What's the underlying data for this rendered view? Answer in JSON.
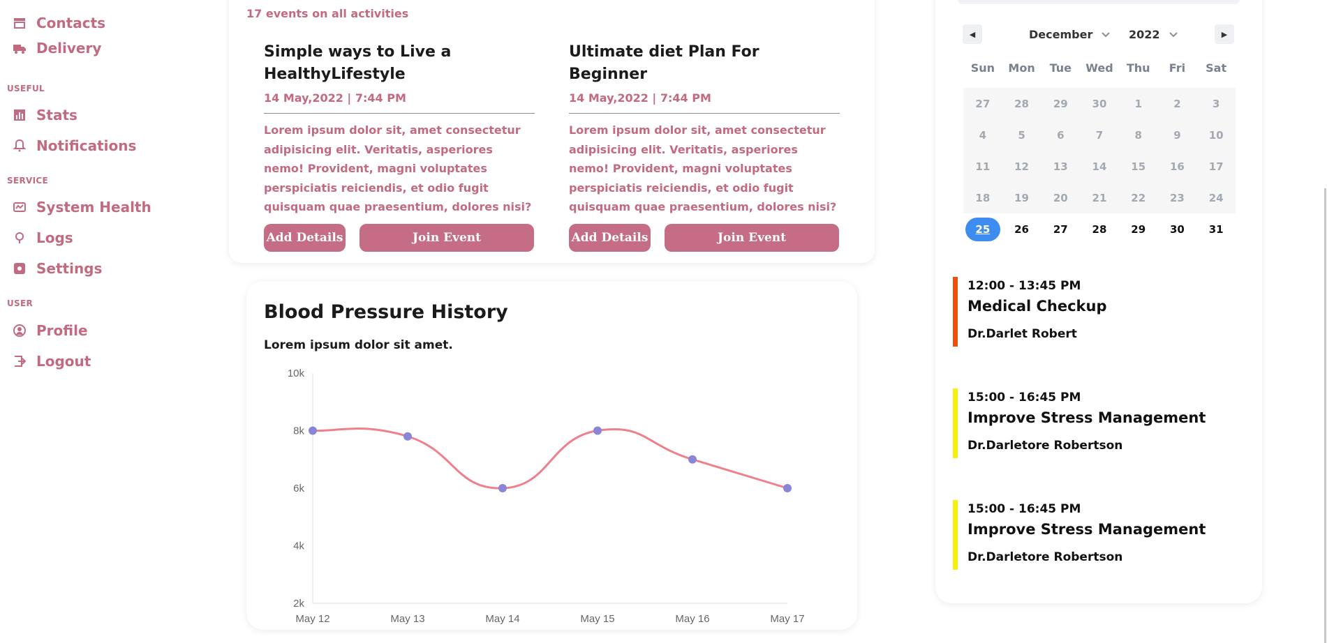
{
  "sidebar": {
    "items_top": [
      {
        "label": "Contacts",
        "icon": "store-icon"
      },
      {
        "label": "Delivery",
        "icon": "truck-icon"
      }
    ],
    "sections": [
      {
        "label": "USEFUL",
        "items": [
          {
            "label": "Stats",
            "icon": "chart-icon"
          },
          {
            "label": "Notifications",
            "icon": "bell-icon"
          }
        ]
      },
      {
        "label": "SERVICE",
        "items": [
          {
            "label": "System Health",
            "icon": "health-icon"
          },
          {
            "label": "Logs",
            "icon": "logs-icon"
          },
          {
            "label": "Settings",
            "icon": "settings-icon"
          }
        ]
      },
      {
        "label": "USER",
        "items": [
          {
            "label": "Profile",
            "icon": "user-icon"
          },
          {
            "label": "Logout",
            "icon": "logout-icon"
          }
        ]
      }
    ]
  },
  "events": {
    "count_text": "17 events on all activities",
    "items": [
      {
        "title": "Simple ways to Live a HealthyLifestyle",
        "date": "14 May,2022 | 7:44 PM",
        "description": "Lorem ipsum dolor sit, amet consectetur adipisicing elit. Veritatis, asperiores nemo! Provident, magni voluptates perspiciatis reiciendis, et odio fugit quisquam quae praesentium, dolores nisi?",
        "details_label": "Add Details",
        "join_label": "Join Event"
      },
      {
        "title": "Ultimate diet Plan For Beginner",
        "date": "14 May,2022 | 7:44 PM",
        "description": "Lorem ipsum dolor sit, amet consectetur adipisicing elit. Veritatis, asperiores nemo! Provident, magni voluptates perspiciatis reiciendis, et odio fugit quisquam quae praesentium, dolores nisi?",
        "details_label": "Add Details",
        "join_label": "Join Event"
      }
    ]
  },
  "chart_card": {
    "title": "Blood Pressure History",
    "subtitle": "Lorem ipsum dolor sit amet."
  },
  "chart_data": {
    "type": "line",
    "categories": [
      "May 12",
      "May 13",
      "May 14",
      "May 15",
      "May 16",
      "May 17"
    ],
    "series": [
      {
        "values": [
          8000,
          7800,
          6000,
          8000,
          7000,
          6000
        ],
        "color": "#f07f8c",
        "point_color": "#8a86d6"
      }
    ],
    "ylim": [
      2000,
      10000
    ],
    "yticks": [
      {
        "value": 2000,
        "label": "2k"
      },
      {
        "value": 4000,
        "label": "4k"
      },
      {
        "value": 6000,
        "label": "6k"
      },
      {
        "value": 8000,
        "label": "8k"
      },
      {
        "value": 10000,
        "label": "10k"
      }
    ],
    "curve": "smooth"
  },
  "calendar": {
    "month": "December",
    "year": "2022",
    "weekdays": [
      "Sun",
      "Mon",
      "Tue",
      "Wed",
      "Thu",
      "Fri",
      "Sat"
    ],
    "weeks": [
      [
        "27",
        "28",
        "29",
        "30",
        "1",
        "2",
        "3"
      ],
      [
        "4",
        "5",
        "6",
        "7",
        "8",
        "9",
        "10"
      ],
      [
        "11",
        "12",
        "13",
        "14",
        "15",
        "16",
        "17"
      ],
      [
        "18",
        "19",
        "20",
        "21",
        "22",
        "23",
        "24"
      ],
      [
        "25",
        "26",
        "27",
        "28",
        "29",
        "30",
        "31"
      ]
    ],
    "selected_day": "25",
    "prev_icon": "caret-left-icon",
    "next_icon": "caret-right-icon"
  },
  "appointments": [
    {
      "time": "12:00 - 13:45 PM",
      "title": "Medical Checkup",
      "doctor": "Dr.Darlet Robert",
      "color": "#f04e0f"
    },
    {
      "time": "15:00 - 16:45 PM",
      "title": "Improve Stress Management",
      "doctor": "Dr.Darletore Robertson",
      "color": "#f5f00f"
    },
    {
      "time": "15:00 - 16:45 PM",
      "title": "Improve Stress Management",
      "doctor": "Dr.Darletore Robertson",
      "color": "#f5f00f"
    }
  ],
  "colors": {
    "accent": "#c46d84",
    "text_accent": "#c26b80",
    "selected_day": "#3d8cf0"
  }
}
